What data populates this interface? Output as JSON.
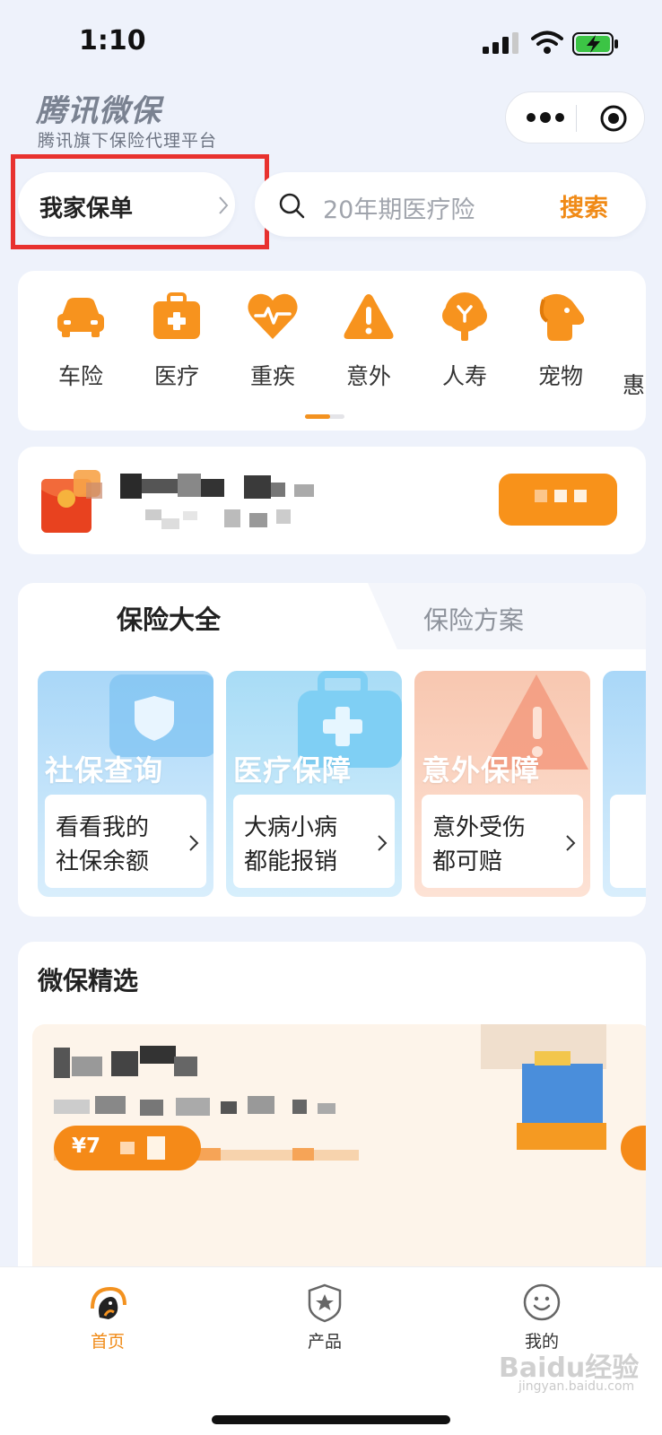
{
  "status_bar": {
    "time": "1:10"
  },
  "header": {
    "brand_title": "腾讯微保",
    "brand_subtitle": "腾讯旗下保险代理平台"
  },
  "policy_button": {
    "label": "我家保单"
  },
  "search": {
    "placeholder": "20年期医疗险",
    "button_label": "搜索"
  },
  "categories": [
    {
      "label": "车险",
      "icon": "car-icon"
    },
    {
      "label": "医疗",
      "icon": "medical-kit-icon"
    },
    {
      "label": "重疾",
      "icon": "heart-pulse-icon"
    },
    {
      "label": "意外",
      "icon": "warning-icon"
    },
    {
      "label": "人寿",
      "icon": "tree-icon"
    },
    {
      "label": "宠物",
      "icon": "pet-icon"
    }
  ],
  "insurance_tabs": [
    {
      "label": "保险大全",
      "active": true
    },
    {
      "label": "保险方案",
      "active": false
    }
  ],
  "service_cards": [
    {
      "title": "社保查询",
      "line1": "看看我的",
      "line2": "社保余额"
    },
    {
      "title": "医疗保障",
      "line1": "大病小病",
      "line2": "都能报销"
    },
    {
      "title": "意外保障",
      "line1": "意外受伤",
      "line2": "都可赔"
    }
  ],
  "picks": {
    "title": "微保精选",
    "price_prefix": "¥7"
  },
  "bottom_nav": [
    {
      "label": "首页",
      "active": true
    },
    {
      "label": "产品",
      "active": false
    },
    {
      "label": "我的",
      "active": false
    }
  ],
  "watermark": {
    "text": "Baidu经验",
    "sub": "jingyan.baidu.com"
  },
  "colors": {
    "accent": "#f08a16",
    "highlight_box": "#e8322f",
    "background": "#eef2fb"
  }
}
